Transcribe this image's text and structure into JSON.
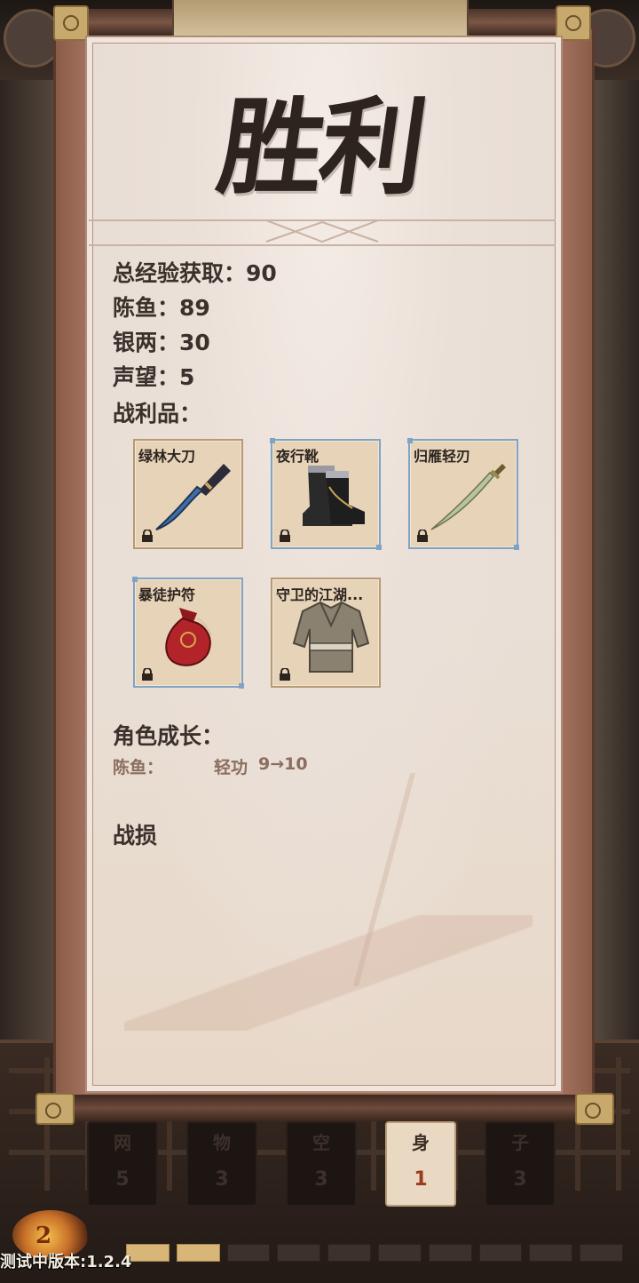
{
  "title": "胜利",
  "rewards": {
    "total_exp": "总经验获取：90",
    "character_exp": "陈鱼：89",
    "silver": "银两：30",
    "reputation": "声望：5",
    "loot_label": "战利品："
  },
  "loot": [
    {
      "name": "绿林大刀",
      "icon": "broadsword-icon",
      "locked": true,
      "border": "gold"
    },
    {
      "name": "夜行靴",
      "icon": "boots-icon",
      "locked": true,
      "border": "blue"
    },
    {
      "name": "归雁轻刃",
      "icon": "saber-icon",
      "locked": true,
      "border": "blue"
    },
    {
      "name": "暴徒护符",
      "icon": "pouch-icon",
      "locked": true,
      "border": "blue"
    },
    {
      "name": "守卫的江湖...",
      "icon": "robe-icon",
      "locked": true,
      "border": "gold"
    }
  ],
  "growth": {
    "label": "角色成长：",
    "rows": [
      {
        "character": "陈鱼：",
        "skill": "轻功",
        "change": "9→10"
      }
    ]
  },
  "losses": {
    "label": "战损"
  },
  "attributes": [
    {
      "name": "网",
      "value": "5",
      "active": false
    },
    {
      "name": "物",
      "value": "3",
      "active": false
    },
    {
      "name": "空",
      "value": "3",
      "active": false
    },
    {
      "name": "身",
      "value": "1",
      "active": true
    },
    {
      "name": "子",
      "value": "3",
      "active": false
    }
  ],
  "emblem_number": "2",
  "progress": {
    "filled": 2,
    "total": 10
  },
  "version": "测试中版本:1.2.4",
  "colors": {
    "paper": "#e9dfd6",
    "wood": "#9a6a57",
    "text": "#3b302b",
    "accent_blue": "#7fa3c4",
    "progress_fill": "#d8b678"
  }
}
